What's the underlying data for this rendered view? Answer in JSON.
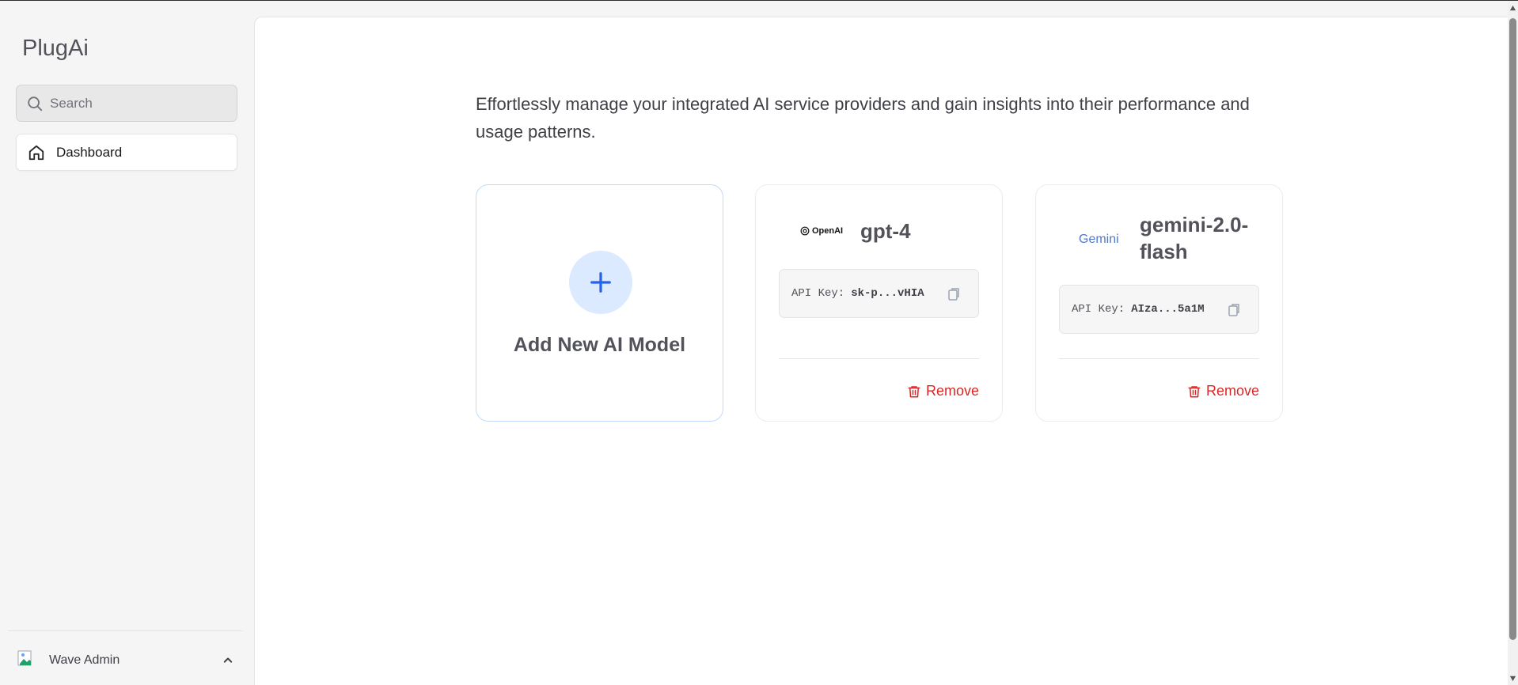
{
  "app": {
    "brand": "PlugAi"
  },
  "sidebar": {
    "search_placeholder": "Search",
    "nav": [
      {
        "label": "Dashboard",
        "icon": "home-icon",
        "active": true
      }
    ],
    "user": {
      "name": "Wave Admin"
    }
  },
  "main": {
    "intro": "Effortlessly manage your integrated AI service providers and gain insights into their performance and usage patterns.",
    "add_card": {
      "label": "Add New AI Model"
    },
    "models": [
      {
        "provider": "OpenAI",
        "provider_logo_text": "OpenAI",
        "name": "gpt-4",
        "api_key_label": "API Key:",
        "api_key": "sk-p...vHIA",
        "remove_label": "Remove"
      },
      {
        "provider": "Gemini",
        "provider_logo_text": "Gemini",
        "name": "gemini-2.0-flash",
        "name_line1": "gemini-2.0-",
        "name_line2": "flash",
        "api_key_label": "API Key:",
        "api_key": "AIza...5a1M",
        "remove_label": "Remove"
      }
    ]
  },
  "colors": {
    "accent": "#2563eb",
    "accent_soft": "#dbeafe",
    "danger": "#dc2626"
  }
}
